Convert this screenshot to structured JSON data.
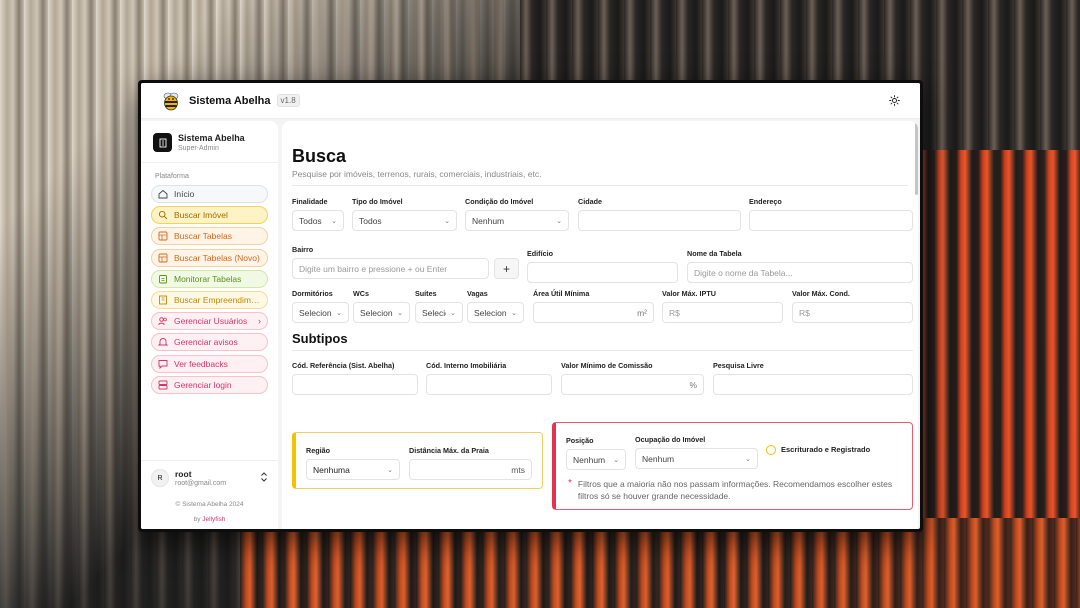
{
  "app": {
    "title": "Sistema Abelha",
    "version": "v1.8"
  },
  "sidebar": {
    "org_name": "Sistema Abelha",
    "org_role": "Super-Admin",
    "group_label": "Plataforma",
    "items": [
      {
        "label": "Início",
        "icon": "home-icon",
        "style": "gray"
      },
      {
        "label": "Buscar Imóvel",
        "icon": "search-icon",
        "style": "yellow"
      },
      {
        "label": "Buscar Tabelas",
        "icon": "table-icon",
        "style": "orange"
      },
      {
        "label": "Buscar Tabelas (Novo)",
        "icon": "table-icon",
        "style": "orange"
      },
      {
        "label": "Monitorar Tabelas",
        "icon": "clipboard-icon",
        "style": "green"
      },
      {
        "label": "Buscar Empreendime...",
        "icon": "building-icon",
        "style": "amber"
      },
      {
        "label": "Gerenciar Usuários",
        "icon": "users-icon",
        "style": "pink",
        "chevron": "›"
      },
      {
        "label": "Gerenciar avisos",
        "icon": "bell-icon",
        "style": "pink"
      },
      {
        "label": "Ver feedbacks",
        "icon": "message-icon",
        "style": "pink"
      },
      {
        "label": "Gerenciar login",
        "icon": "layout-icon",
        "style": "pink"
      }
    ],
    "user": {
      "initial": "R",
      "name": "root",
      "email": "root@gmail.com"
    },
    "copyright": "© Sistema Abelha 2024",
    "byline_prefix": "by",
    "byline_brand": "Jellyfish"
  },
  "page": {
    "title": "Busca",
    "subtitle": "Pesquise por imóveis, terrenos, rurais, comerciais, industriais, etc."
  },
  "filters": {
    "finalidade": {
      "label": "Finalidade",
      "value": "Todos"
    },
    "tipo": {
      "label": "Tipo do Imóvel",
      "value": "Todos"
    },
    "condicao": {
      "label": "Condição do Imóvel",
      "value": "Nenhum"
    },
    "cidade": {
      "label": "Cidade",
      "value": ""
    },
    "endereco": {
      "label": "Endereço",
      "value": ""
    },
    "bairro": {
      "label": "Bairro",
      "placeholder": "Digite um bairro e pressione + ou Enter",
      "button": "+"
    },
    "edificio": {
      "label": "Edifício",
      "value": ""
    },
    "nome_tabela": {
      "label": "Nome da Tabela",
      "placeholder": "Digite o nome da Tabela..."
    },
    "dormitorios": {
      "label": "Dormitórios",
      "value": "Selecione"
    },
    "wcs": {
      "label": "WCs",
      "value": "Selecione"
    },
    "suites": {
      "label": "Suítes",
      "value": "Selecione"
    },
    "vagas": {
      "label": "Vagas",
      "value": "Selecione"
    },
    "area": {
      "label": "Área Útil Mínima",
      "suffix": "m²"
    },
    "iptu": {
      "label": "Valor Máx. IPTU",
      "prefix": "R$"
    },
    "cond": {
      "label": "Valor Máx. Cond.",
      "prefix": "R$"
    }
  },
  "subtipos": {
    "title": "Subtipos",
    "cod_ref": {
      "label": "Cód. Referência (Sist. Abelha)"
    },
    "cod_int": {
      "label": "Cód. Interno Imobiliária"
    },
    "comissao": {
      "label": "Valor Mínimo de Comissão",
      "suffix": "%"
    },
    "pesquisa": {
      "label": "Pesquisa Livre"
    }
  },
  "regiao_card": {
    "regiao": {
      "label": "Região",
      "value": "Nenhuma"
    },
    "distancia": {
      "label": "Distância Máx. da Praia",
      "suffix": "mts"
    }
  },
  "warning_card": {
    "posicao": {
      "label": "Posição",
      "value": "Nenhum"
    },
    "ocupacao": {
      "label": "Ocupação do Imóvel",
      "value": "Nenhum"
    },
    "checkbox_label": "Escriturado e Registrado",
    "star": "*",
    "text": "Filtros que a maioria não nos passam informações. Recomendamos escolher estes filtros só se houver grande necessidade."
  }
}
